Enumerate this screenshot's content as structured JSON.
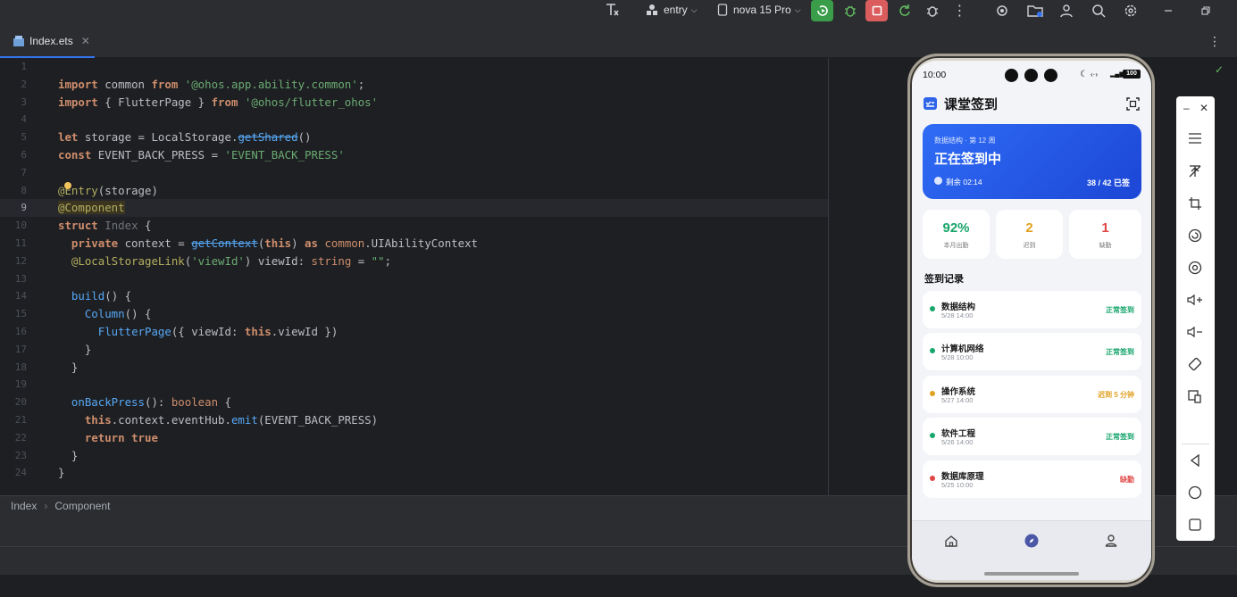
{
  "toolbar": {
    "module": "entry",
    "device": "nova 15 Pro",
    "colors": {
      "run_green": "#3a9d4a",
      "stop_red": "#db5c5c"
    }
  },
  "editor": {
    "tab_label": "Index.ets",
    "line_numbers": [
      "1",
      "2",
      "3",
      "4",
      "5",
      "6",
      "7",
      "8",
      "9",
      "10",
      "11",
      "12",
      "13",
      "14",
      "15",
      "16",
      "17",
      "18",
      "19",
      "20",
      "21",
      "22",
      "23",
      "24"
    ],
    "code": {
      "l2": [
        "import",
        " common ",
        "from",
        " ",
        "'@ohos.app.ability.common'",
        ";"
      ],
      "l3": [
        "import",
        " { FlutterPage } ",
        "from",
        " ",
        "'@ohos/flutter_ohos'"
      ],
      "l5": [
        "let",
        " storage = LocalStorage.",
        "getShared",
        "()"
      ],
      "l6": [
        "const",
        " EVENT_BACK_PRESS = ",
        "'EVENT_BACK_PRESS'"
      ],
      "l8": [
        "@Entry",
        "(storage)"
      ],
      "l9": [
        "@Component"
      ],
      "l10": [
        "struct",
        " ",
        "Index",
        " {"
      ],
      "l11": [
        "  ",
        "private",
        " context = ",
        "getContext",
        "(",
        "this",
        ") ",
        "as",
        " ",
        "common",
        ".UIAbilityContext"
      ],
      "l12": [
        "  ",
        "@LocalStorageLink",
        "(",
        "'viewId'",
        ") viewId: ",
        "string",
        " = ",
        "\"\"",
        ";"
      ],
      "l14": [
        "  ",
        "build",
        "() {"
      ],
      "l15": [
        "    ",
        "Column",
        "() {"
      ],
      "l16": [
        "      ",
        "FlutterPage",
        "({ viewId: ",
        "this",
        ".viewId })"
      ],
      "l17": [
        "    }"
      ],
      "l18": [
        "  }"
      ],
      "l20": [
        "  ",
        "onBackPress",
        "(): ",
        "boolean",
        " {"
      ],
      "l21": [
        "    ",
        "this",
        ".context.eventHub.",
        "emit",
        "(EVENT_BACK_PRESS)"
      ],
      "l22": [
        "    ",
        "return",
        " ",
        "true"
      ],
      "l23": [
        "  }"
      ],
      "l24": [
        "}"
      ]
    }
  },
  "breadcrumb": {
    "item1": "Index",
    "sep": "›",
    "item2": "Component"
  },
  "phone": {
    "status_time": "10:00",
    "battery": "100",
    "app_title": "课堂签到",
    "banner": {
      "course": "数据结构 · 第 12 周",
      "status": "正在签到中",
      "remaining": "剩余 02:14",
      "count": "38 / 42 已签",
      "gradient_start": "#2f6cf5",
      "gradient_end": "#1c46d6"
    },
    "stats": [
      {
        "value": "92%",
        "label": "本月出勤",
        "color": "#1aa56a"
      },
      {
        "value": "2",
        "label": "迟到",
        "color": "#e0a021"
      },
      {
        "value": "1",
        "label": "缺勤",
        "color": "#e04646"
      }
    ],
    "records_title": "签到记录",
    "records": [
      {
        "course": "数据结构",
        "time": "5/28 14:00",
        "status": "正常签到",
        "color": "#16a56b"
      },
      {
        "course": "计算机网络",
        "time": "5/28 10:00",
        "status": "正常签到",
        "color": "#16a56b"
      },
      {
        "course": "操作系统",
        "time": "5/27 14:00",
        "status": "迟到 5 分钟",
        "color": "#e0a021"
      },
      {
        "course": "软件工程",
        "time": "5/26 14:00",
        "status": "正常签到",
        "color": "#16a56b"
      },
      {
        "course": "数据库原理",
        "time": "5/25 10:00",
        "status": "缺勤",
        "color": "#e04646"
      }
    ],
    "nav": [
      "home-icon",
      "compass-icon",
      "user-icon"
    ]
  }
}
